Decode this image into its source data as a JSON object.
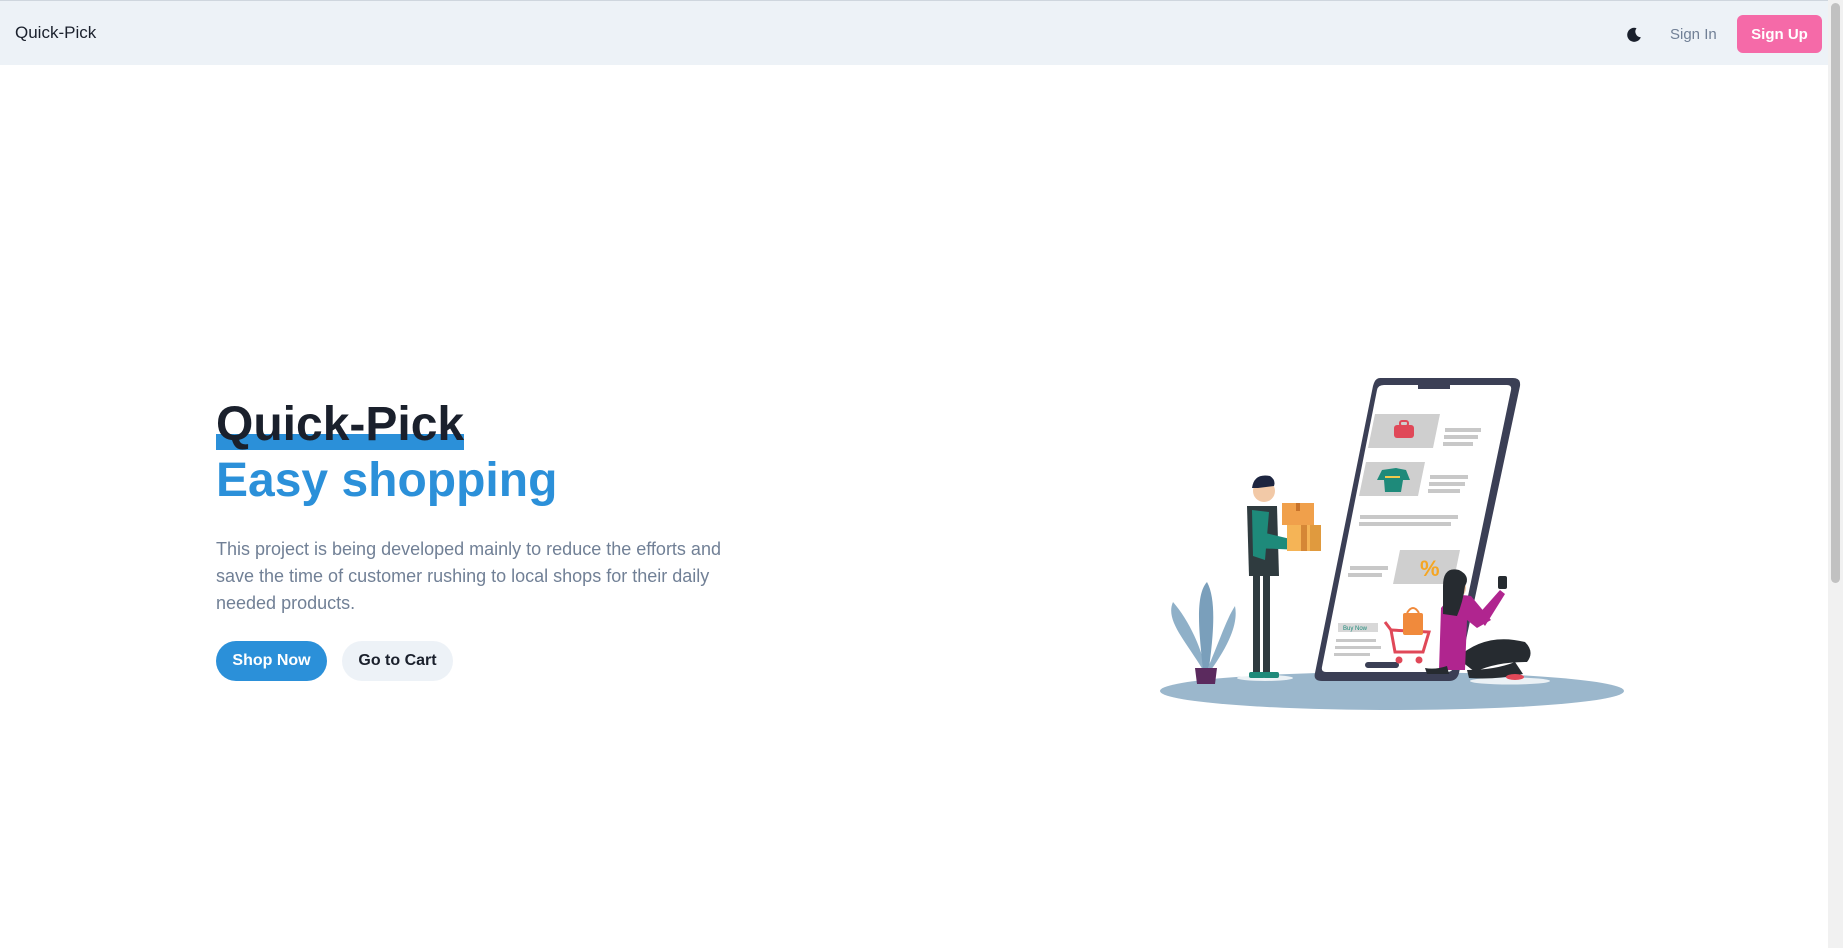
{
  "navbar": {
    "brand": "Quick-Pick",
    "theme_icon": "moon-icon",
    "signin_label": "Sign In",
    "signup_label": "Sign Up",
    "signup_color": "#f56aa8"
  },
  "hero": {
    "title_line1": "Quick-Pick",
    "title_line2": "Easy shopping",
    "description": "This project is being developed mainly to reduce the efforts and save the time of customer rushing to local shops for their daily needed products.",
    "shop_button": "Shop Now",
    "cart_button": "Go to Cart",
    "accent_color": "#2b90d9"
  },
  "illustration": {
    "icon": "shopping-illustration",
    "phone_button": "Buy Now",
    "discount_symbol": "%"
  }
}
